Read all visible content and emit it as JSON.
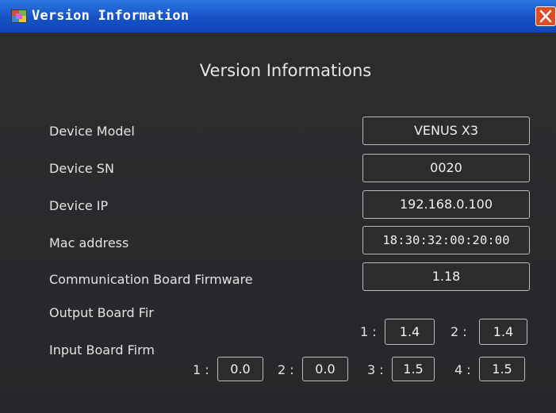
{
  "window": {
    "title": "Version Information",
    "heading": "Version Informations"
  },
  "fields": [
    {
      "label": "Device Model",
      "value": "VENUS X3"
    },
    {
      "label": "Device SN",
      "value": "0020"
    },
    {
      "label": "Device IP",
      "value": "192.168.0.100"
    },
    {
      "label": "Mac address",
      "value": "18:30:32:00:20:00"
    },
    {
      "label": "Communication Board Firmware",
      "value": "1.18"
    }
  ],
  "output_board": {
    "label": "Output Board Fir",
    "slots": [
      {
        "index": "1 :",
        "value": "1.4"
      },
      {
        "index": "2 :",
        "value": "1.4"
      }
    ]
  },
  "input_board": {
    "label": "Input Board Firm",
    "slots": [
      {
        "index": "1 :",
        "value": "0.0"
      },
      {
        "index": "2 :",
        "value": "0.0"
      },
      {
        "index": "3 :",
        "value": "1.5"
      },
      {
        "index": "4 :",
        "value": "1.5"
      }
    ]
  },
  "colors": {
    "titlebar": "#1652c8",
    "panel_background": "#27292b",
    "close_button": "#e24a21",
    "text": "#e3e3e3",
    "box_border": "#b9b9b9"
  },
  "icons": {
    "app": "app-icon",
    "close": "close-icon"
  }
}
